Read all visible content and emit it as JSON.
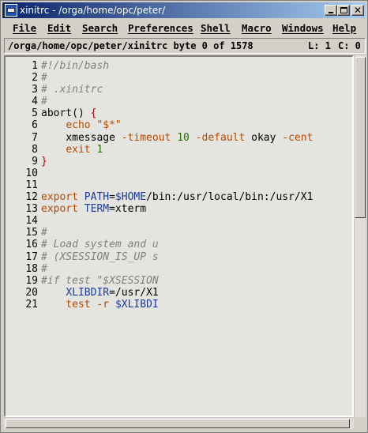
{
  "window": {
    "title": "xinitrc - /orga/home/opc/peter/"
  },
  "menu": [
    {
      "label": "File"
    },
    {
      "label": "Edit"
    },
    {
      "label": "Search"
    },
    {
      "label": "Preferences"
    },
    {
      "label": "Shell"
    },
    {
      "label": "Macro"
    },
    {
      "label": "Windows"
    },
    {
      "label": "Help"
    }
  ],
  "status": {
    "path": "/orga/home/opc/peter/xinitrc byte 0 of 1578",
    "line": "L: 1",
    "col": "C: 0"
  },
  "editor": {
    "line_numbers": [
      "1",
      "2",
      "3",
      "4",
      "5",
      "6",
      "7",
      "8",
      "9",
      "10",
      "11",
      "12",
      "13",
      "14",
      "15",
      "16",
      "17",
      "18",
      "19",
      "20",
      "21"
    ],
    "lines": [
      "#!/bin/bash",
      "#",
      "# .xinitrc",
      "#",
      "abort() {",
      "    echo \"$*\"",
      "    xmessage -timeout 10 -default okay -cent",
      "    exit 1",
      "}",
      "",
      "",
      "export PATH=$HOME/bin:/usr/local/bin:/usr/X1",
      "export TERM=xterm",
      "",
      "#",
      "# Load system and u",
      "# (XSESSION_IS_UP s",
      "#",
      "#if test \"$XSESSION",
      "    XLIBDIR=/usr/X1",
      "    test -r $XLIBDI"
    ]
  },
  "colors": {
    "titlebar_start": "#0a246a",
    "editor_bg": "#e4e4e0",
    "keyword": "#b84a00",
    "variable": "#1e3a9e",
    "comment": "#808080",
    "number": "#2a6e00"
  },
  "icons": {
    "app": "nedit-app-icon",
    "minimize": "minimize-icon",
    "maximize": "maximize-icon",
    "close": "close-icon"
  }
}
